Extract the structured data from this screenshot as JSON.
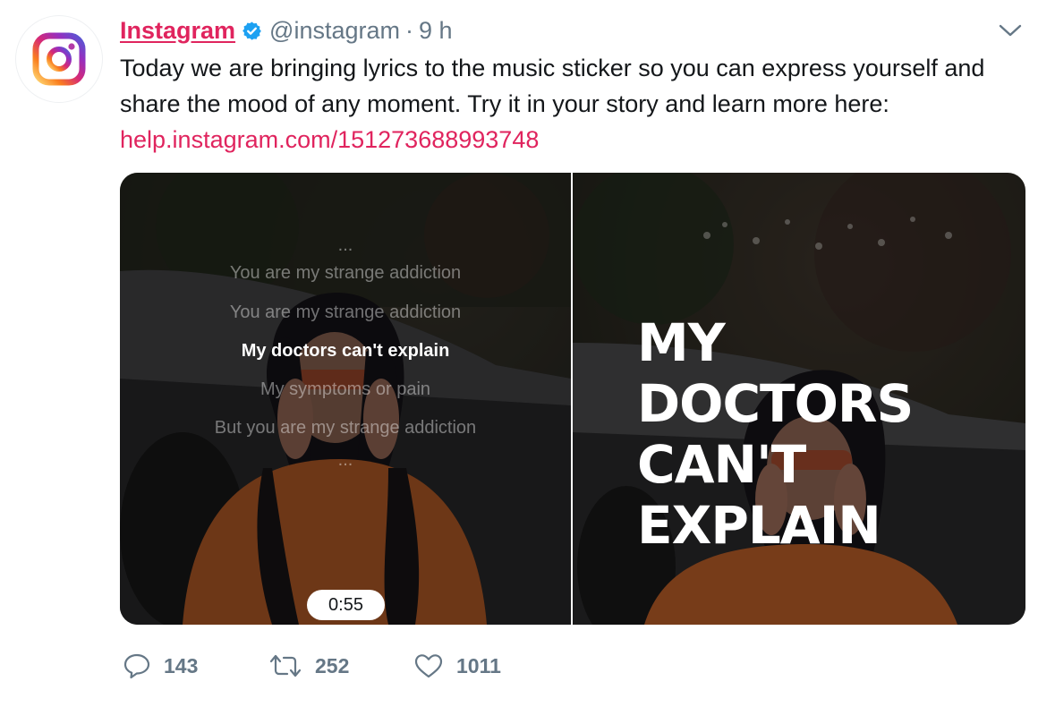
{
  "account": {
    "name": "Instagram",
    "handle": "@instagram",
    "separator": "·",
    "time": "9 h"
  },
  "tweet": {
    "text": "Today we are bringing lyrics to the music sticker so you can express yourself and share the mood of any moment. Try it in your story and learn more here:",
    "link": "help.instagram.com/151273688993748"
  },
  "media": {
    "left": {
      "lyrics": [
        "...",
        "You are my strange addiction",
        "You are my strange addiction",
        "My doctors can't explain",
        "My symptoms or pain",
        "But you are my strange addiction",
        "..."
      ],
      "active_index": 3,
      "duration": "0:55"
    },
    "right": {
      "big_lyric": "MY DOCTORS CAN'T EXPLAIN"
    }
  },
  "actions": {
    "reply_count": "143",
    "retweet_count": "252",
    "like_count": "1011"
  },
  "colors": {
    "brand_link": "#e0245e",
    "muted": "#657786",
    "verified": "#1da1f2"
  }
}
